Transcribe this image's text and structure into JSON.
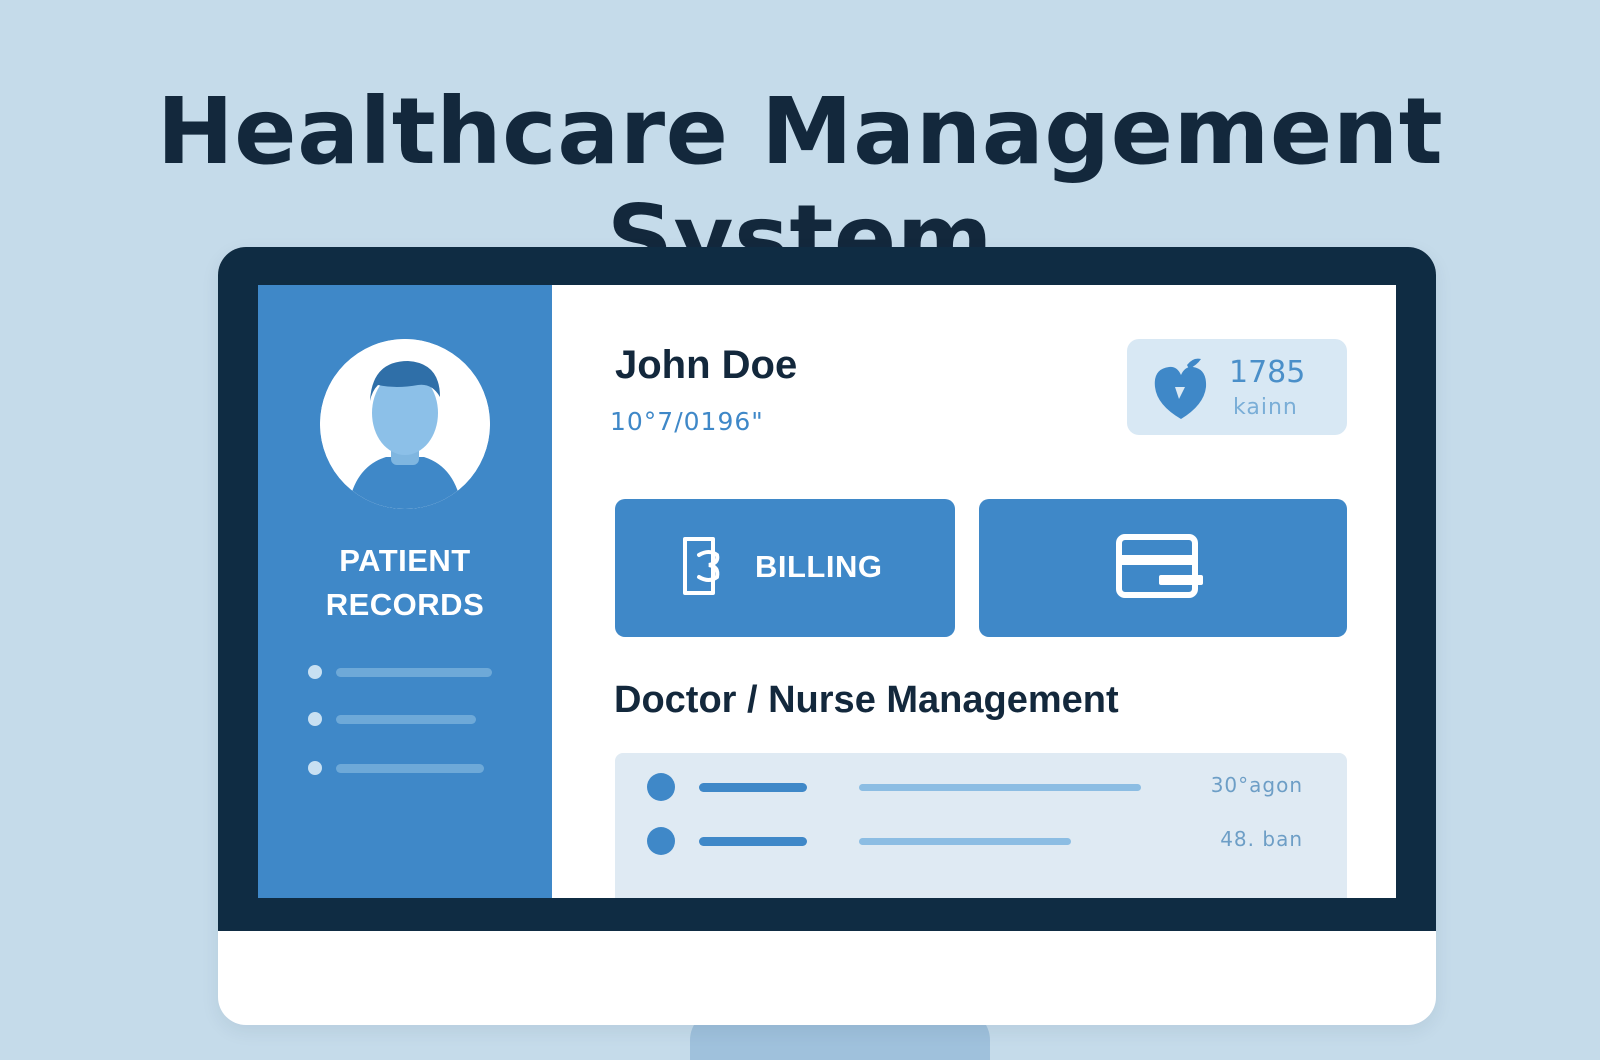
{
  "page_title": "Healthcare Management System",
  "sidebar": {
    "avatar_icon": "user-avatar-icon",
    "title_line1": "PATIENT",
    "title_line2": "RECORDS",
    "items": [
      {
        "label": ""
      },
      {
        "label": ""
      },
      {
        "label": ""
      }
    ]
  },
  "patient": {
    "name": "John Doe",
    "id_text": "10°7/0196\""
  },
  "vitals": {
    "icon": "heart-icon",
    "value": "1785",
    "unit": "kainn"
  },
  "actions": {
    "billing_label": "BILLING",
    "billing_icon": "billing-document-icon",
    "card_icon": "credit-card-icon"
  },
  "staff_section": {
    "title": "Doctor / Nurse Management",
    "rows": [
      {
        "meta": "30°agon"
      },
      {
        "meta": "48. ban"
      }
    ]
  },
  "colors": {
    "background": "#c5dbea",
    "bezel": "#0f2c43",
    "accent": "#3f88c8",
    "title_text": "#13283c"
  }
}
